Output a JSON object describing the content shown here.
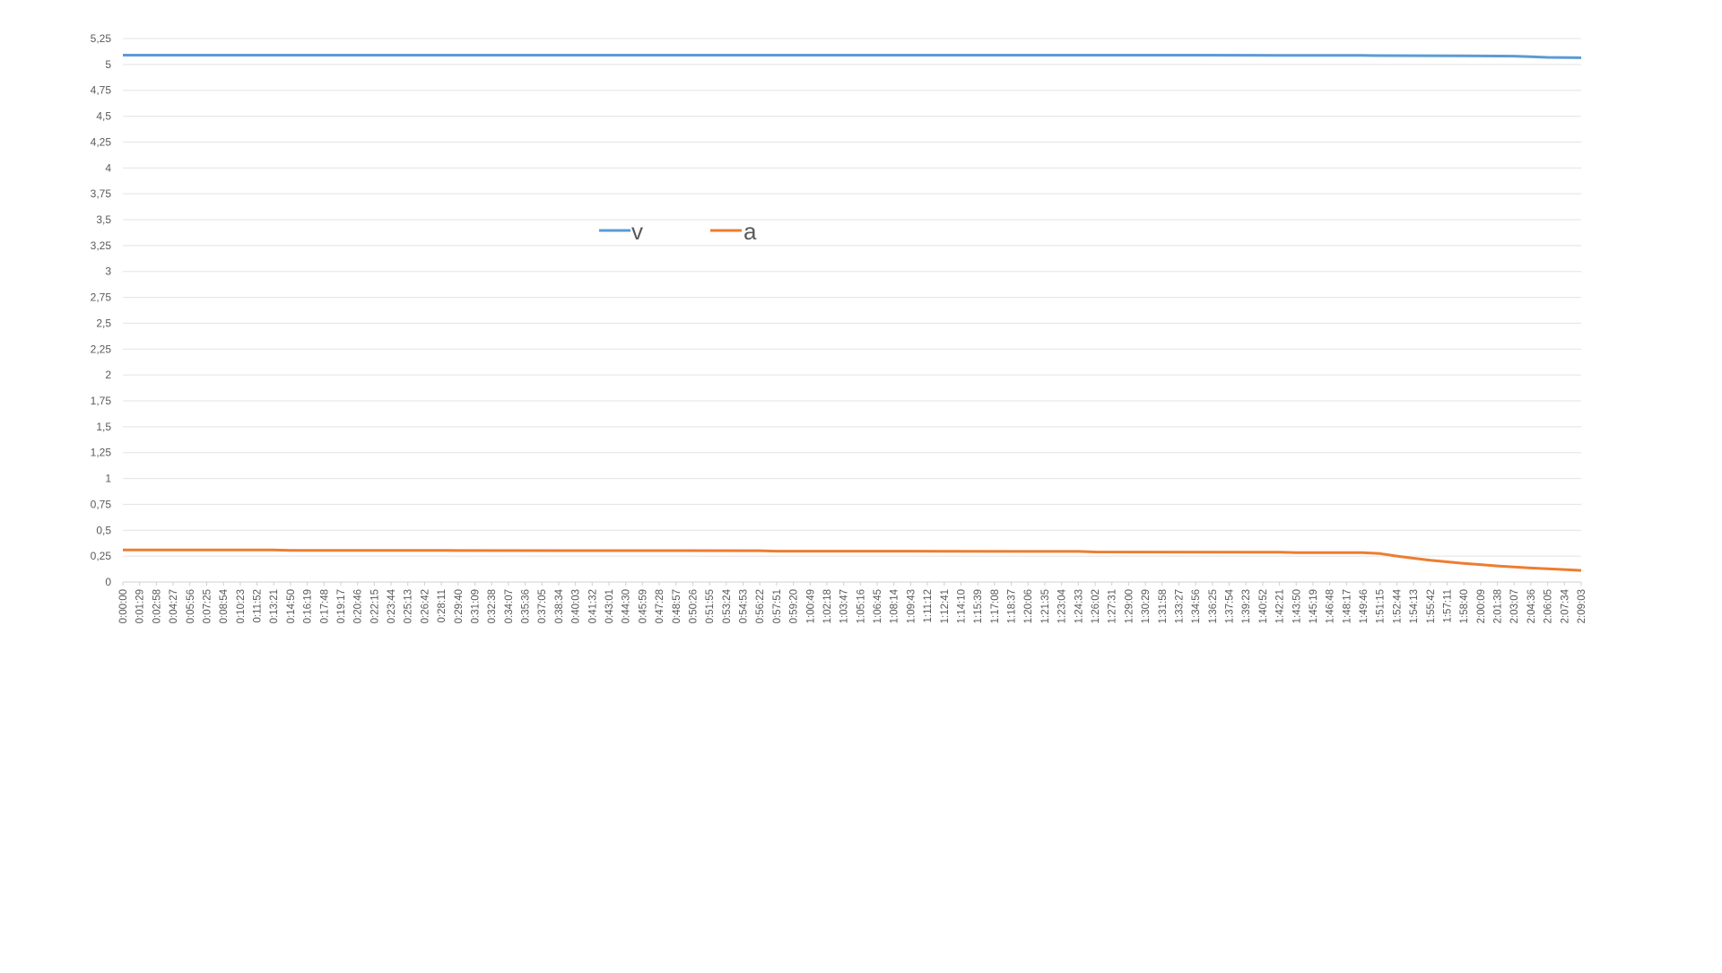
{
  "chart_data": {
    "type": "line",
    "title": "",
    "xlabel": "",
    "ylabel": "",
    "ylim": [
      0,
      5.25
    ],
    "grid": true,
    "legend_position": "upper-middle",
    "y_ticks": [
      "0",
      "0,25",
      "0,5",
      "0,75",
      "1",
      "1,25",
      "1,5",
      "1,75",
      "2",
      "2,25",
      "2,5",
      "2,75",
      "3",
      "3,25",
      "3,5",
      "3,75",
      "4",
      "4,25",
      "4,5",
      "4,75",
      "5",
      "5,25"
    ],
    "x_ticks": [
      "0:00:00",
      "0:01:29",
      "0:02:58",
      "0:04:27",
      "0:05:56",
      "0:07:25",
      "0:08:54",
      "0:10:23",
      "0:11:52",
      "0:13:21",
      "0:14:50",
      "0:16:19",
      "0:17:48",
      "0:19:17",
      "0:20:46",
      "0:22:15",
      "0:23:44",
      "0:25:13",
      "0:26:42",
      "0:28:11",
      "0:29:40",
      "0:31:09",
      "0:32:38",
      "0:34:07",
      "0:35:36",
      "0:37:05",
      "0:38:34",
      "0:40:03",
      "0:41:32",
      "0:43:01",
      "0:44:30",
      "0:45:59",
      "0:47:28",
      "0:48:57",
      "0:50:26",
      "0:51:55",
      "0:53:24",
      "0:54:53",
      "0:56:22",
      "0:57:51",
      "0:59:20",
      "1:00:49",
      "1:02:18",
      "1:03:47",
      "1:05:16",
      "1:06:45",
      "1:08:14",
      "1:09:43",
      "1:11:12",
      "1:12:41",
      "1:14:10",
      "1:15:39",
      "1:17:08",
      "1:18:37",
      "1:20:06",
      "1:21:35",
      "1:23:04",
      "1:24:33",
      "1:26:02",
      "1:27:31",
      "1:29:00",
      "1:30:29",
      "1:31:58",
      "1:33:27",
      "1:34:56",
      "1:36:25",
      "1:37:54",
      "1:39:23",
      "1:40:52",
      "1:42:21",
      "1:43:50",
      "1:45:19",
      "1:46:48",
      "1:48:17",
      "1:49:46",
      "1:51:15",
      "1:52:44",
      "1:54:13",
      "1:55:42",
      "1:57:11",
      "1:58:40",
      "2:00:09",
      "2:01:38",
      "2:03:07",
      "2:04:36",
      "2:06:05",
      "2:07:34",
      "2:09:03"
    ],
    "series": [
      {
        "name": "v",
        "color": "#5b9bd5",
        "points": [
          [
            "0:00:00",
            5.09
          ],
          [
            "0:13:21",
            5.09
          ],
          [
            "0:28:11",
            5.09
          ],
          [
            "0:43:01",
            5.09
          ],
          [
            "0:57:51",
            5.09
          ],
          [
            "1:12:41",
            5.09
          ],
          [
            "1:27:31",
            5.09
          ],
          [
            "1:34:56",
            5.09
          ],
          [
            "1:42:21",
            5.088
          ],
          [
            "1:49:46",
            5.087
          ],
          [
            "1:51:15",
            5.085
          ],
          [
            "1:58:40",
            5.083
          ],
          [
            "2:03:07",
            5.08
          ],
          [
            "2:04:36",
            5.075
          ],
          [
            "2:06:05",
            5.068
          ],
          [
            "2:09:03",
            5.065
          ]
        ]
      },
      {
        "name": "a",
        "color": "#ed7d31",
        "points": [
          [
            "0:00:00",
            0.31
          ],
          [
            "0:13:21",
            0.31
          ],
          [
            "0:14:50",
            0.305
          ],
          [
            "0:28:11",
            0.305
          ],
          [
            "0:43:01",
            0.303
          ],
          [
            "0:56:22",
            0.302
          ],
          [
            "0:57:51",
            0.298
          ],
          [
            "1:12:41",
            0.297
          ],
          [
            "1:24:33",
            0.295
          ],
          [
            "1:26:02",
            0.29
          ],
          [
            "1:42:21",
            0.288
          ],
          [
            "1:43:50",
            0.284
          ],
          [
            "1:49:46",
            0.283
          ],
          [
            "1:51:15",
            0.275
          ],
          [
            "1:52:44",
            0.25
          ],
          [
            "1:54:13",
            0.23
          ],
          [
            "1:55:42",
            0.21
          ],
          [
            "1:57:11",
            0.195
          ],
          [
            "1:58:40",
            0.18
          ],
          [
            "2:00:09",
            0.168
          ],
          [
            "2:01:38",
            0.155
          ],
          [
            "2:03:07",
            0.145
          ],
          [
            "2:04:36",
            0.135
          ],
          [
            "2:06:05",
            0.127
          ],
          [
            "2:07:34",
            0.12
          ],
          [
            "2:09:03",
            0.112
          ]
        ]
      }
    ]
  }
}
